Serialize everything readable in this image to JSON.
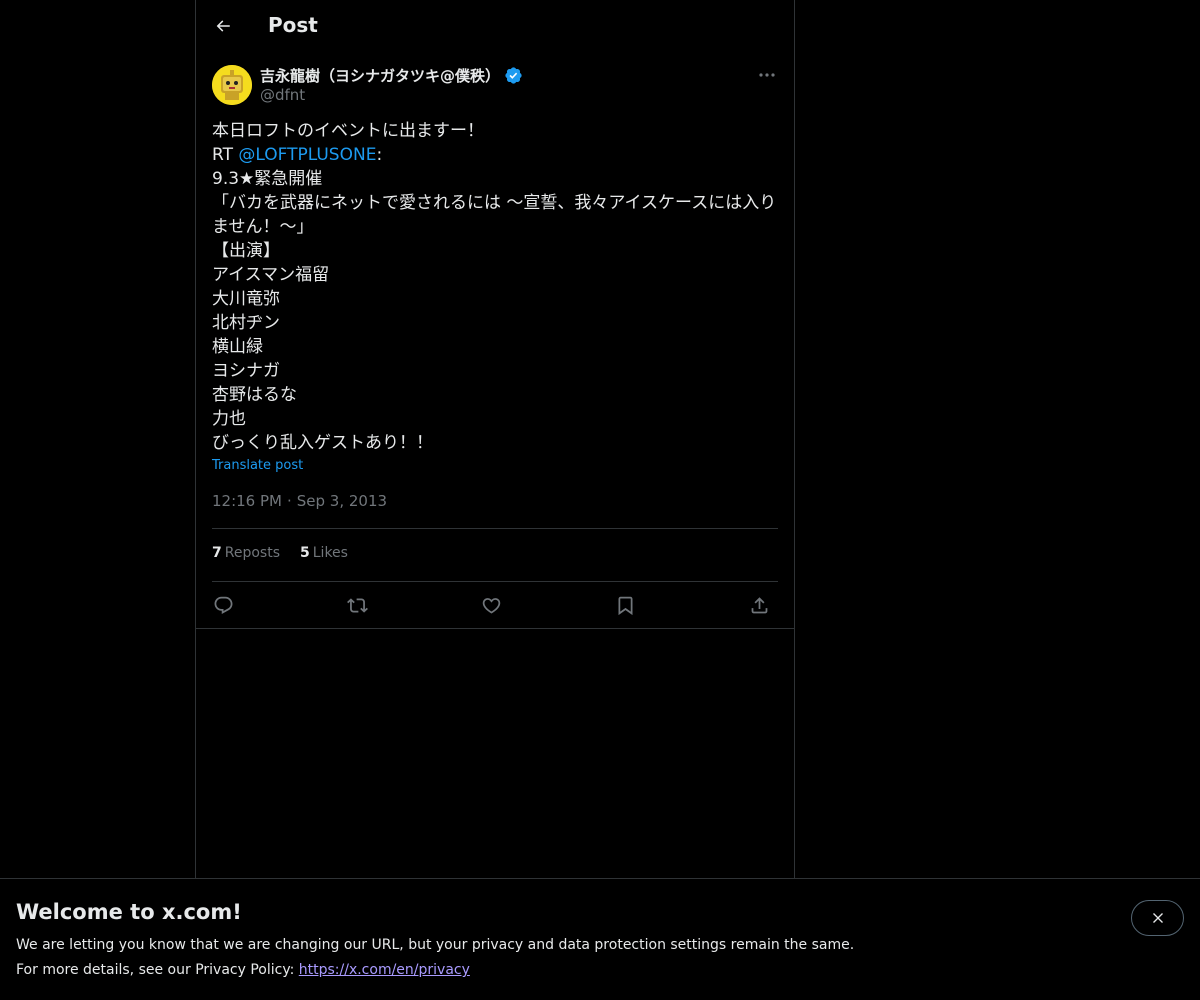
{
  "header": {
    "title": "Post"
  },
  "post": {
    "author": {
      "display_name": "吉永龍樹（ヨシナガタツキ@僕秩）",
      "handle": "@dfnt",
      "verified": true
    },
    "text": {
      "line1": "本日ロフトのイベントに出ますー！",
      "rt_prefix": "RT ",
      "mention": "@LOFTPLUSONE",
      "rt_suffix": ":",
      "line3": "9.3★緊急開催",
      "line4": "「バカを武器にネットで愛されるには ～宣誓、我々アイスケースには入りません！～」",
      "line5": "【出演】",
      "line6": "アイスマン福留",
      "line7": "大川竜弥",
      "line8": "北村ヂン",
      "line9": "横山緑",
      "line10": "ヨシナガ",
      "line11": "杏野はるな",
      "line12": "力也",
      "line13": "びっくり乱入ゲストあり！！"
    },
    "translate_label": "Translate post",
    "time": "12:16 PM",
    "separator": "·",
    "date": "Sep 3, 2013",
    "stats": {
      "reposts_count": "7",
      "reposts_label": "Reposts",
      "likes_count": "5",
      "likes_label": "Likes"
    },
    "actions": [
      "reply-icon",
      "repost-icon",
      "like-icon",
      "bookmark-icon",
      "share-icon"
    ]
  },
  "banner": {
    "title": "Welcome to x.com!",
    "line1": "We are letting you know that we are changing our URL, but your privacy and data protection settings remain the same.",
    "line2_prefix": "For more details, see our Privacy Policy: ",
    "link": "https://x.com/en/privacy"
  },
  "colors": {
    "background": "#000000",
    "text": "#e7e9ea",
    "secondary": "#71767b",
    "accent": "#1d9bf0",
    "link_visited": "#a99bff",
    "border": "#2f3336"
  }
}
